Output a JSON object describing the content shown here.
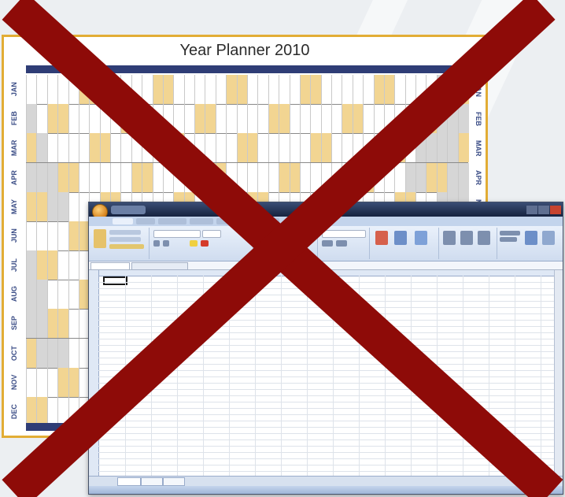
{
  "planner": {
    "title": "Year Planner 2010",
    "months": [
      "JAN",
      "FEB",
      "MAR",
      "APR",
      "MAY",
      "JUN",
      "JUL",
      "AUG",
      "SEP",
      "OCT",
      "NOV",
      "DEC"
    ]
  },
  "colors": {
    "planner_border": "#e2ad35",
    "weekend_fill": "#f2d592",
    "header_navy": "#2f3d76",
    "cross_red": "#8e0b08"
  },
  "icons": [
    "office-button-icon",
    "cross-mark-icon"
  ]
}
